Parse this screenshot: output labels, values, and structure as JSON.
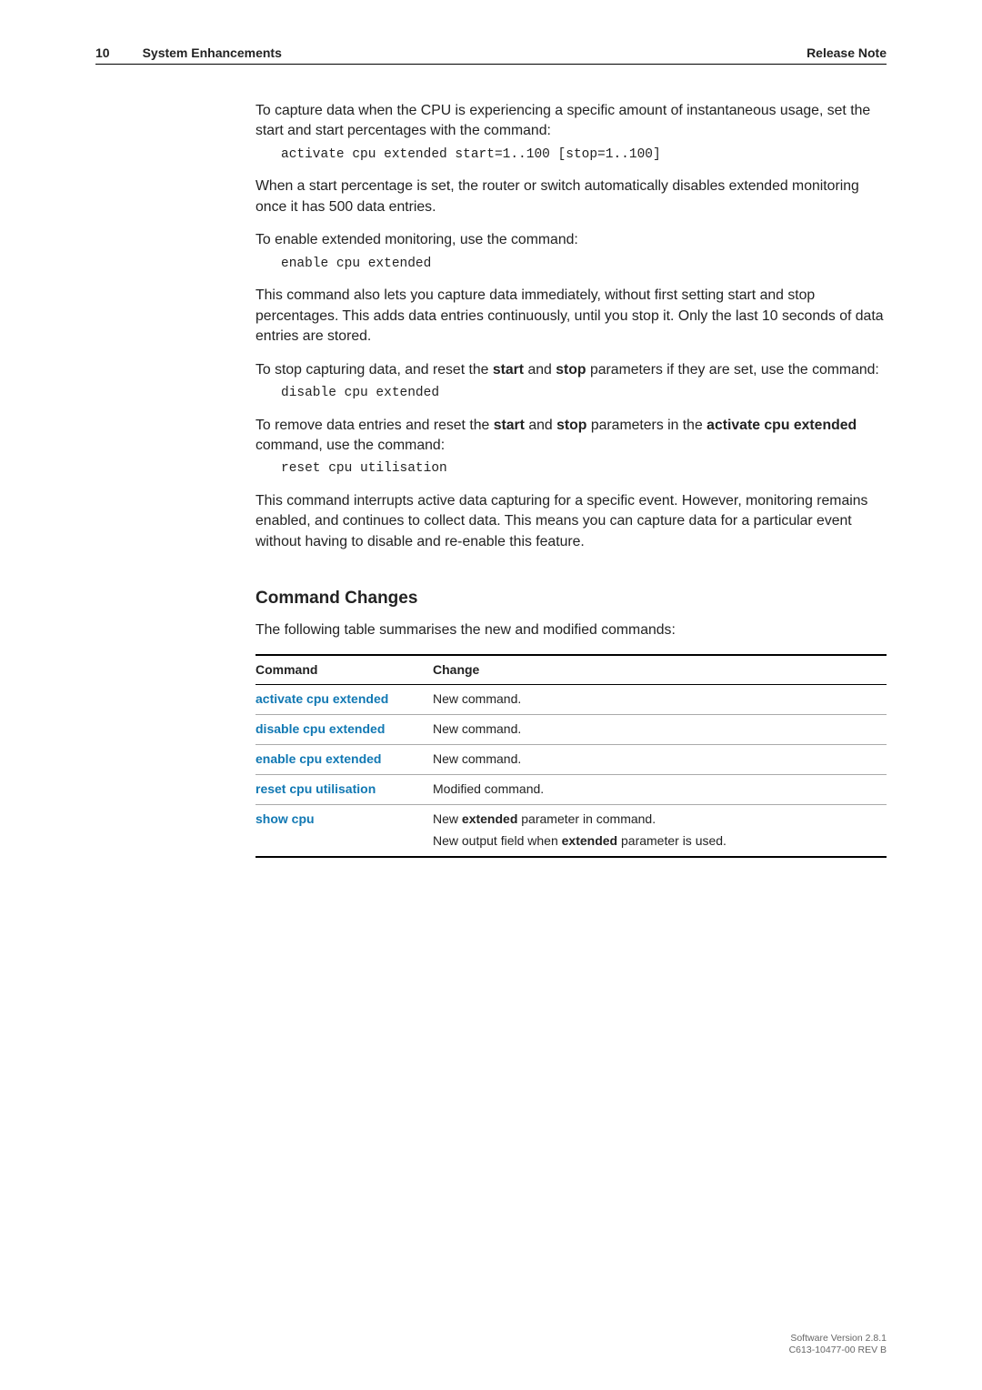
{
  "header": {
    "pageno": "10",
    "section": "System Enhancements",
    "doctype": "Release Note"
  },
  "body": {
    "p1": "To capture data when the CPU is experiencing a specific amount of instantaneous usage, set the start and start percentages with the command:",
    "code1": "activate cpu extended start=1..100 [stop=1..100]",
    "p2": "When a start percentage is set, the router or switch automatically disables extended monitoring once it has 500 data entries.",
    "p3": "To enable extended monitoring, use the command:",
    "code2": "enable cpu extended",
    "p4": "This command also lets you capture data immediately, without first setting start and stop percentages. This adds data entries continuously, until you stop it. Only the last 10 seconds of data entries are stored.",
    "p5a": "To stop capturing data, and reset the ",
    "p5b": "start",
    "p5c": " and ",
    "p5d": "stop",
    "p5e": " parameters if they are set, use the command:",
    "code3": "disable cpu extended",
    "p6a": "To remove data entries and reset the ",
    "p6b": "start",
    "p6c": " and ",
    "p6d": "stop",
    "p6e": " parameters in the ",
    "p6f": "activate cpu extended",
    "p6g": " command, use the command:",
    "code4": "reset cpu utilisation",
    "p7": "This command interrupts active data capturing for a specific event. However, monitoring remains enabled, and continues to collect data. This means you can capture data for a particular event without having to disable and re-enable this feature.",
    "h2": "Command Changes",
    "p8": "The following table summarises the new and modified commands:"
  },
  "table": {
    "head_command": "Command",
    "head_change": "Change",
    "rows": [
      {
        "cmd": "activate cpu extended",
        "change_pre": "New command.",
        "change_bold": "",
        "change_post": "",
        "line2_pre": "",
        "line2_bold": "",
        "line2_post": ""
      },
      {
        "cmd": "disable cpu extended",
        "change_pre": "New command.",
        "change_bold": "",
        "change_post": "",
        "line2_pre": "",
        "line2_bold": "",
        "line2_post": ""
      },
      {
        "cmd": "enable cpu extended",
        "change_pre": "New command.",
        "change_bold": "",
        "change_post": "",
        "line2_pre": "",
        "line2_bold": "",
        "line2_post": ""
      },
      {
        "cmd": "reset cpu utilisation",
        "change_pre": "Modified command.",
        "change_bold": "",
        "change_post": "",
        "line2_pre": "",
        "line2_bold": "",
        "line2_post": ""
      },
      {
        "cmd": "show cpu",
        "change_pre": "New ",
        "change_bold": "extended",
        "change_post": " parameter in command.",
        "line2_pre": "New output field when ",
        "line2_bold": "extended",
        "line2_post": " parameter is used."
      }
    ]
  },
  "footer": {
    "line1": "Software Version 2.8.1",
    "line2": "C613-10477-00 REV B"
  }
}
